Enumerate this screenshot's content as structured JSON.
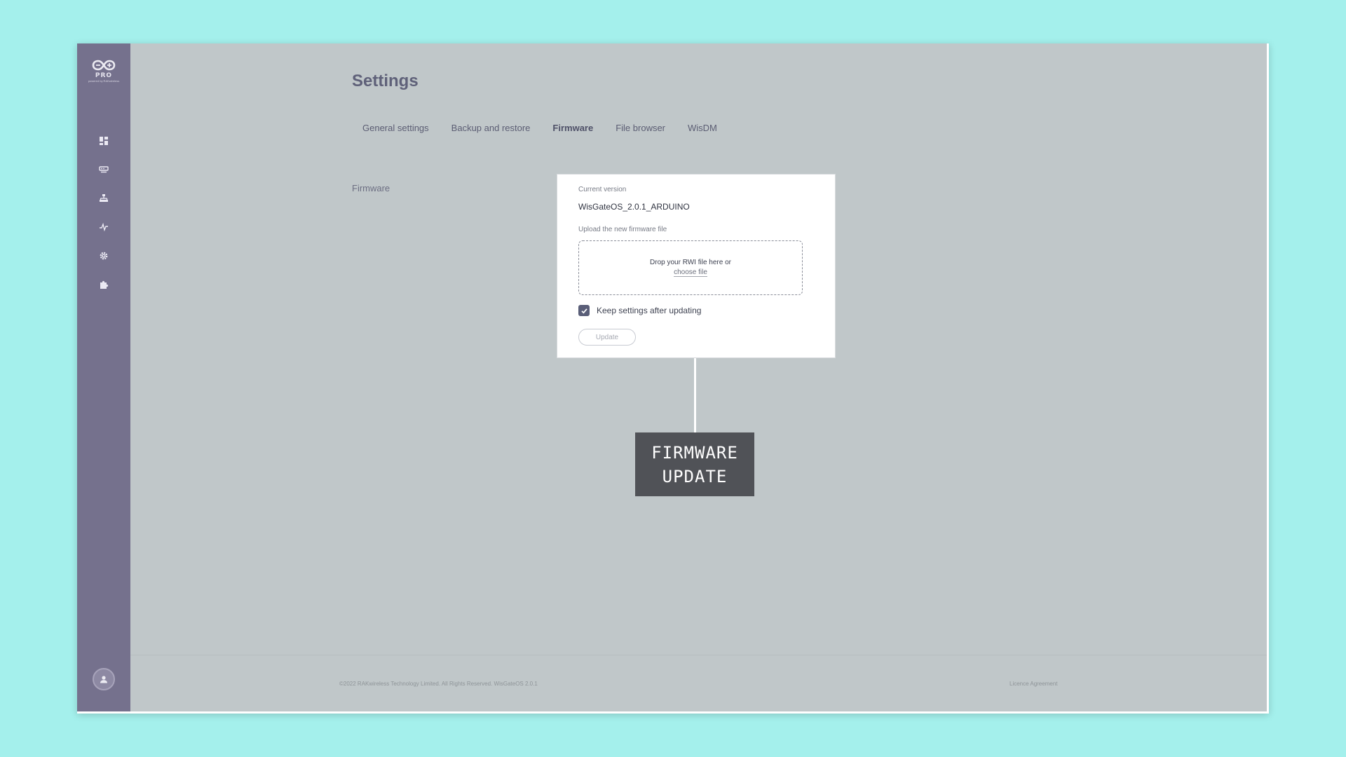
{
  "brand": {
    "logo_text": "PRO",
    "logo_tagline": "powered by RAKwireless"
  },
  "sidebar": {
    "items": [
      {
        "icon": "dashboard-icon"
      },
      {
        "icon": "gateway-icon"
      },
      {
        "icon": "network-icon"
      },
      {
        "icon": "activity-icon"
      },
      {
        "icon": "gear-icon"
      },
      {
        "icon": "puzzle-icon"
      }
    ],
    "profile_icon": "user-icon"
  },
  "page": {
    "title": "Settings"
  },
  "tabs": [
    {
      "label": "General settings",
      "active": false
    },
    {
      "label": "Backup and restore",
      "active": false
    },
    {
      "label": "Firmware",
      "active": true
    },
    {
      "label": "File browser",
      "active": false
    },
    {
      "label": "WisDM",
      "active": false
    }
  ],
  "firmware": {
    "section_label": "Firmware",
    "current_version_label": "Current version",
    "current_version_value": "WisGateOS_2.0.1_ARDUINO",
    "upload_label": "Upload the new firmware file",
    "dropzone_text": "Drop your RWI file here or",
    "dropzone_link": "choose file",
    "keep_settings_label": "Keep settings after updating",
    "keep_settings_checked": true,
    "update_button": "Update"
  },
  "callout": {
    "line1": "FIRMWARE",
    "line2": "UPDATE"
  },
  "footer": {
    "copyright": "©2022 RAKwireless Technology Limited. All Rights Reserved. WisGateOS 2.0.1",
    "licence_link": "Licence Agreement"
  },
  "colors": {
    "background": "#a4f0ec",
    "sidebar": "#75718d",
    "content": "#c0c7c9",
    "card": "#ffffff",
    "checkbox": "#5a5e78",
    "callout": "#505257"
  }
}
